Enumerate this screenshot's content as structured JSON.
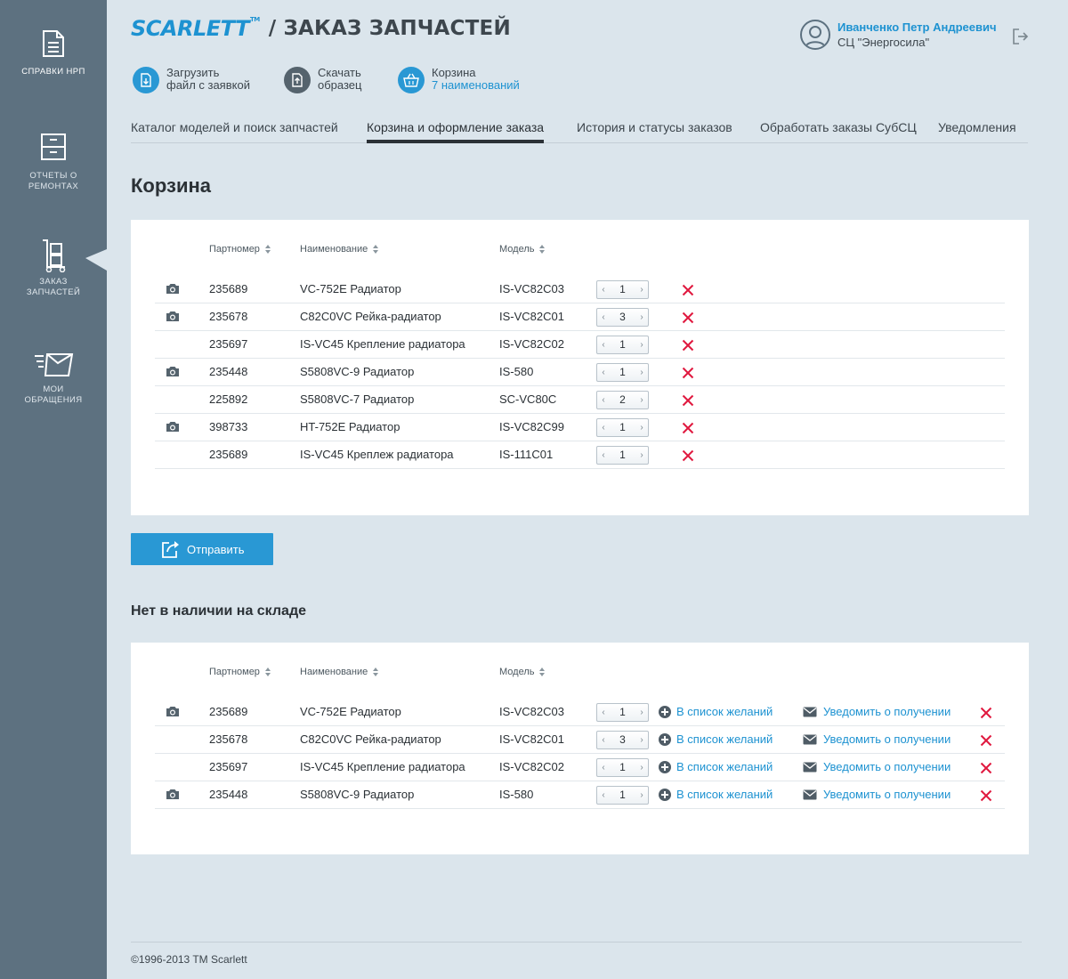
{
  "sidebar": {
    "items": [
      {
        "label": "Справки НРП",
        "icon": "document-icon"
      },
      {
        "label": "Отчеты о ремонтах",
        "icon": "cabinet-icon"
      },
      {
        "label": "Заказ запчастей",
        "icon": "trolley-icon",
        "active": true
      },
      {
        "label": "Мои обращения",
        "icon": "envelope-icon"
      }
    ]
  },
  "header": {
    "logo": "SCARLETT",
    "logo_tm": "TM",
    "title": "/ ЗАКАЗ ЗАПЧАСТЕЙ",
    "user_name": "Иванченко Петр Андреевич",
    "user_org": "СЦ \"Энергосила\""
  },
  "quick_actions": {
    "upload": {
      "line1": "Загрузить",
      "line2": "файл с заявкой"
    },
    "download": {
      "line1": "Скачать",
      "line2": "образец"
    },
    "cart": {
      "line1": "Корзина",
      "line2": "7 наименований"
    }
  },
  "tabs": [
    "Каталог моделей и поиск запчастей",
    "Корзина и оформление заказа",
    "История и статусы заказов",
    "Обработать заказы СубСЦ",
    "Уведомления"
  ],
  "active_tab": 1,
  "cart": {
    "heading": "Корзина",
    "columns": {
      "partnumber": "Партномер",
      "name": "Наименование",
      "model": "Модель"
    },
    "rows": [
      {
        "photo": true,
        "partnumber": "235689",
        "name": "VC-752E Радиатор",
        "model": "IS-VC82C03",
        "qty": "1"
      },
      {
        "photo": true,
        "partnumber": "235678",
        "name": "C82C0VC Рейка-радиатор",
        "model": "IS-VC82C01",
        "qty": "3"
      },
      {
        "photo": false,
        "partnumber": "235697",
        "name": "IS-VC45 Крепление радиатора",
        "model": "IS-VC82C02",
        "qty": "1"
      },
      {
        "photo": true,
        "partnumber": "235448",
        "name": "S5808VC-9 Радиатор",
        "model": "IS-580",
        "qty": "1"
      },
      {
        "photo": false,
        "partnumber": "225892",
        "name": "S5808VC-7 Радиатор",
        "model": "SC-VC80C",
        "qty": "2"
      },
      {
        "photo": true,
        "partnumber": "398733",
        "name": "HT-752E Радиатор",
        "model": "IS-VC82C99",
        "qty": "1"
      },
      {
        "photo": false,
        "partnumber": "235689",
        "name": "IS-VC45 Креплеж радиатора",
        "model": "IS-111C01",
        "qty": "1"
      }
    ],
    "send_label": "Отправить"
  },
  "out_of_stock": {
    "heading": "Нет в наличии на складе",
    "columns": {
      "partnumber": "Партномер",
      "name": "Наименование",
      "model": "Модель"
    },
    "wish_label": "В список желаний",
    "notify_label": "Уведомить о получении",
    "rows": [
      {
        "photo": true,
        "partnumber": "235689",
        "name": "VC-752E Радиатор",
        "model": "IS-VC82C03",
        "qty": "1"
      },
      {
        "photo": false,
        "partnumber": "235678",
        "name": "C82C0VC Рейка-радиатор",
        "model": "IS-VC82C01",
        "qty": "3"
      },
      {
        "photo": false,
        "partnumber": "235697",
        "name": "IS-VC45 Крепление радиатора",
        "model": "IS-VC82C02",
        "qty": "1"
      },
      {
        "photo": true,
        "partnumber": "235448",
        "name": "S5808VC-9 Радиатор",
        "model": "IS-580",
        "qty": "1"
      }
    ]
  },
  "footer": {
    "copyright": "©1996-2013 TM Scarlett"
  },
  "colors": {
    "accent": "#1d92d1",
    "sidebar": "#5d7180",
    "background": "#dbe5ec",
    "delete": "#e0193f",
    "button": "#2998d4"
  }
}
